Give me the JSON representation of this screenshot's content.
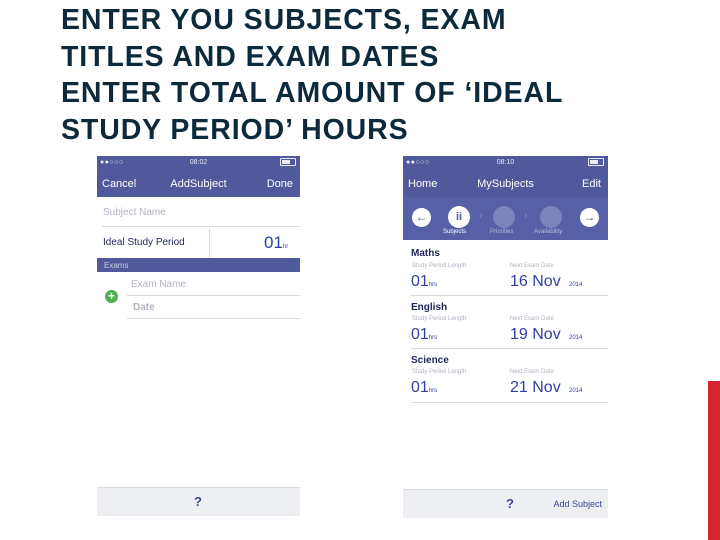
{
  "slide": {
    "title_lines": [
      "ENTER YOU SUBJECTS, EXAM",
      "TITLES AND EXAM DATES",
      "ENTER TOTAL AMOUNT OF ‘IDEAL",
      "STUDY PERIOD’ HOURS"
    ],
    "accent_color": "#d6232f",
    "title_color": "#0d2a3c"
  },
  "phone_add": {
    "status": {
      "signal": "●●○○○",
      "time": "08:02",
      "battery_icon": "battery-icon"
    },
    "nav": {
      "left": "Cancel",
      "title": "AddSubject",
      "right": "Done"
    },
    "subject_name_placeholder": "Subject Name",
    "study_period_label": "Ideal Study Period",
    "study_period_value": "01",
    "study_period_unit": "hr",
    "exams_header": "Exams",
    "exam_name_placeholder": "Exam Name",
    "date_placeholder": "Date",
    "toolbar_help": "?"
  },
  "phone_list": {
    "status": {
      "signal": "●●○○○",
      "time": "08:10",
      "battery_icon": "battery-icon"
    },
    "nav": {
      "left": "Home",
      "title": "MySubjects",
      "right": "Edit"
    },
    "steps": [
      "Subjects",
      "Priorities",
      "Availability"
    ],
    "subjects": [
      {
        "name": "Maths",
        "period_caption": "Study Period Length",
        "period": "01",
        "period_unit": "hrs",
        "date_caption": "Next Exam Date",
        "date": "16 Nov",
        "year": "2014"
      },
      {
        "name": "English",
        "period_caption": "Study Period Length",
        "period": "01",
        "period_unit": "hrs",
        "date_caption": "Next Exam Date",
        "date": "19 Nov",
        "year": "2014"
      },
      {
        "name": "Science",
        "period_caption": "Study Period Length",
        "period": "01",
        "period_unit": "hrs",
        "date_caption": "Next Exam Date",
        "date": "21 Nov",
        "year": "2014"
      }
    ],
    "toolbar_help": "?",
    "toolbar_add": "Add Subject"
  },
  "colors": {
    "nav_bar": "#50599b",
    "accent_blue": "#2f3fa3",
    "plus_green": "#4cb04f"
  }
}
